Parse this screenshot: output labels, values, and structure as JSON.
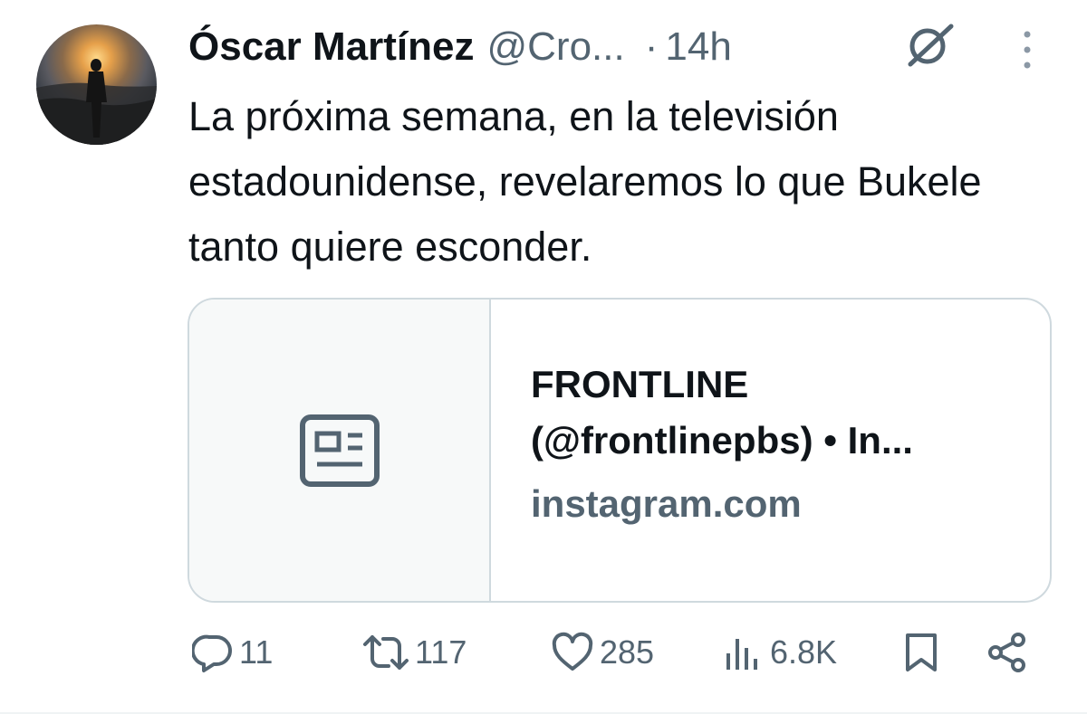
{
  "tweet": {
    "author_name": "Óscar Martínez",
    "author_handle": "@Cro...",
    "separator": "·",
    "time": "14h",
    "text": "La próxima semana, en la televisión estadounidense, revelaremos lo que Bukele tanto quiere esconder."
  },
  "card": {
    "title": "FRONTLINE (@frontlinepbs) • In...",
    "domain": "instagram.com",
    "thumb_icon": "article-icon"
  },
  "actions": {
    "replies": "11",
    "reposts": "117",
    "likes": "285",
    "views": "6.8K"
  },
  "colors": {
    "text_primary": "#0f1419",
    "text_secondary": "#536471",
    "border": "#cfd9de"
  }
}
